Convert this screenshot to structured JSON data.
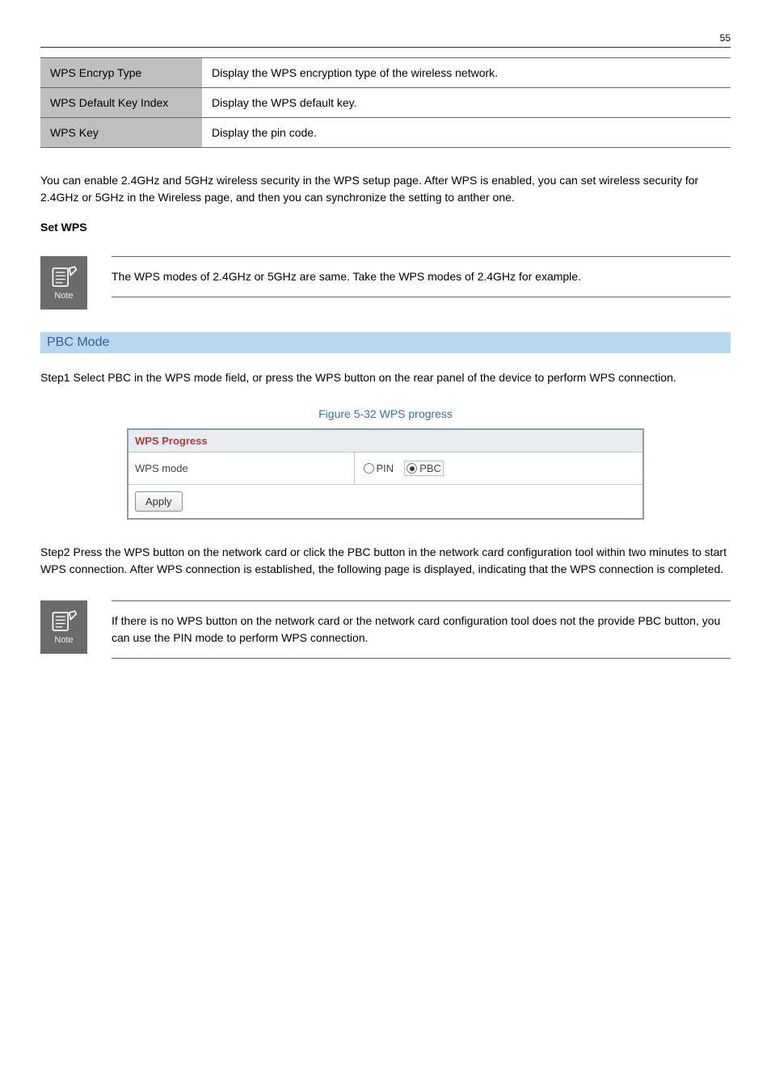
{
  "page_number": "55",
  "spec_rows": [
    {
      "key": "WPS Encryp Type",
      "value": "Display the WPS encryption type of the wireless network."
    },
    {
      "key": "WPS Default Key Index",
      "value": "Display the WPS default key."
    },
    {
      "key": "WPS Key",
      "value": "Display the pin code."
    }
  ],
  "paragraph_mode": "You can enable 2.4GHz and 5GHz wireless security in the WPS setup page. After WPS is enabled, you can set wireless security for 2.4GHz or 5GHz in the Wireless page, and then you can synchronize the setting to anther one.",
  "subheading_mode": "Set WPS",
  "note1_text": "The WPS modes of 2.4GHz or 5GHz are same. Take the WPS modes of 2.4GHz for example.",
  "blue_bar_text": "PBC Mode",
  "step1_text": "Step1 Select PBC in the WPS mode field, or press the WPS button on the rear panel of the device to perform WPS connection.",
  "figure_caption": "Figure 5-32 WPS progress",
  "wps_table": {
    "header": "WPS Progress",
    "mode_label": "WPS mode",
    "options": [
      "PIN",
      "PBC"
    ],
    "selected": "PBC",
    "apply_label": "Apply"
  },
  "step2_text": "Step2 Press the WPS button on the network card or click the PBC button in the network card configuration tool within two minutes to start WPS connection. After WPS connection is established, the following page is displayed, indicating that the WPS connection is completed.",
  "note2_text": "If there is no WPS button on the network card or the network card configuration tool does not the provide PBC button, you can use the PIN mode to perform WPS connection."
}
